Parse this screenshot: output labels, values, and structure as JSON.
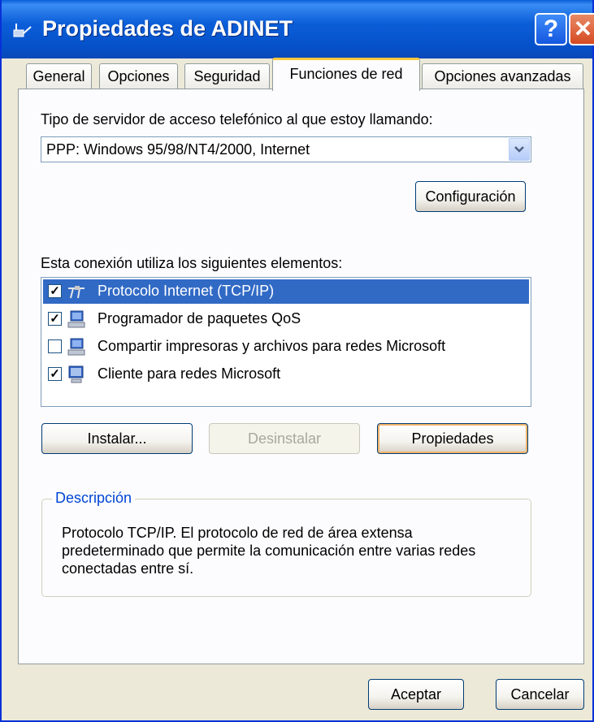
{
  "window": {
    "title": "Propiedades de ADINET",
    "help_label": "?",
    "close_label": "✕"
  },
  "tabs": [
    {
      "label": "General",
      "active": false
    },
    {
      "label": "Opciones",
      "active": false
    },
    {
      "label": "Seguridad",
      "active": false
    },
    {
      "label": "Funciones de red",
      "active": true
    },
    {
      "label": "Opciones avanzadas",
      "active": false
    }
  ],
  "network": {
    "server_type_label": "Tipo de servidor de acceso telefónico al que estoy llamando:",
    "server_type_value": "PPP: Windows 95/98/NT4/2000, Internet",
    "settings_button": "Configuración",
    "components_label": "Esta conexión utiliza los siguientes elementos:",
    "components": [
      {
        "label": "Protocolo Internet (TCP/IP)",
        "checked": true,
        "selected": true,
        "icon": "network-protocol-icon"
      },
      {
        "label": "Programador de paquetes QoS",
        "checked": true,
        "selected": false,
        "icon": "network-service-icon"
      },
      {
        "label": "Compartir impresoras y archivos para redes Microsoft",
        "checked": false,
        "selected": false,
        "icon": "network-service-icon"
      },
      {
        "label": "Cliente para redes Microsoft",
        "checked": true,
        "selected": false,
        "icon": "network-client-icon"
      }
    ],
    "install_button": "Instalar...",
    "uninstall_button": "Desinstalar",
    "properties_button": "Propiedades",
    "description_title": "Descripción",
    "description_text": "Protocolo TCP/IP. El protocolo de red de área extensa predeterminado que permite la comunicación entre varias redes conectadas entre sí."
  },
  "footer": {
    "ok_button": "Aceptar",
    "cancel_button": "Cancelar"
  },
  "colors": {
    "titlebar": "#0a5fd8",
    "selection": "#316ac5",
    "active_tab_accent": "#ffc83c",
    "legend_text": "#0046d5"
  }
}
